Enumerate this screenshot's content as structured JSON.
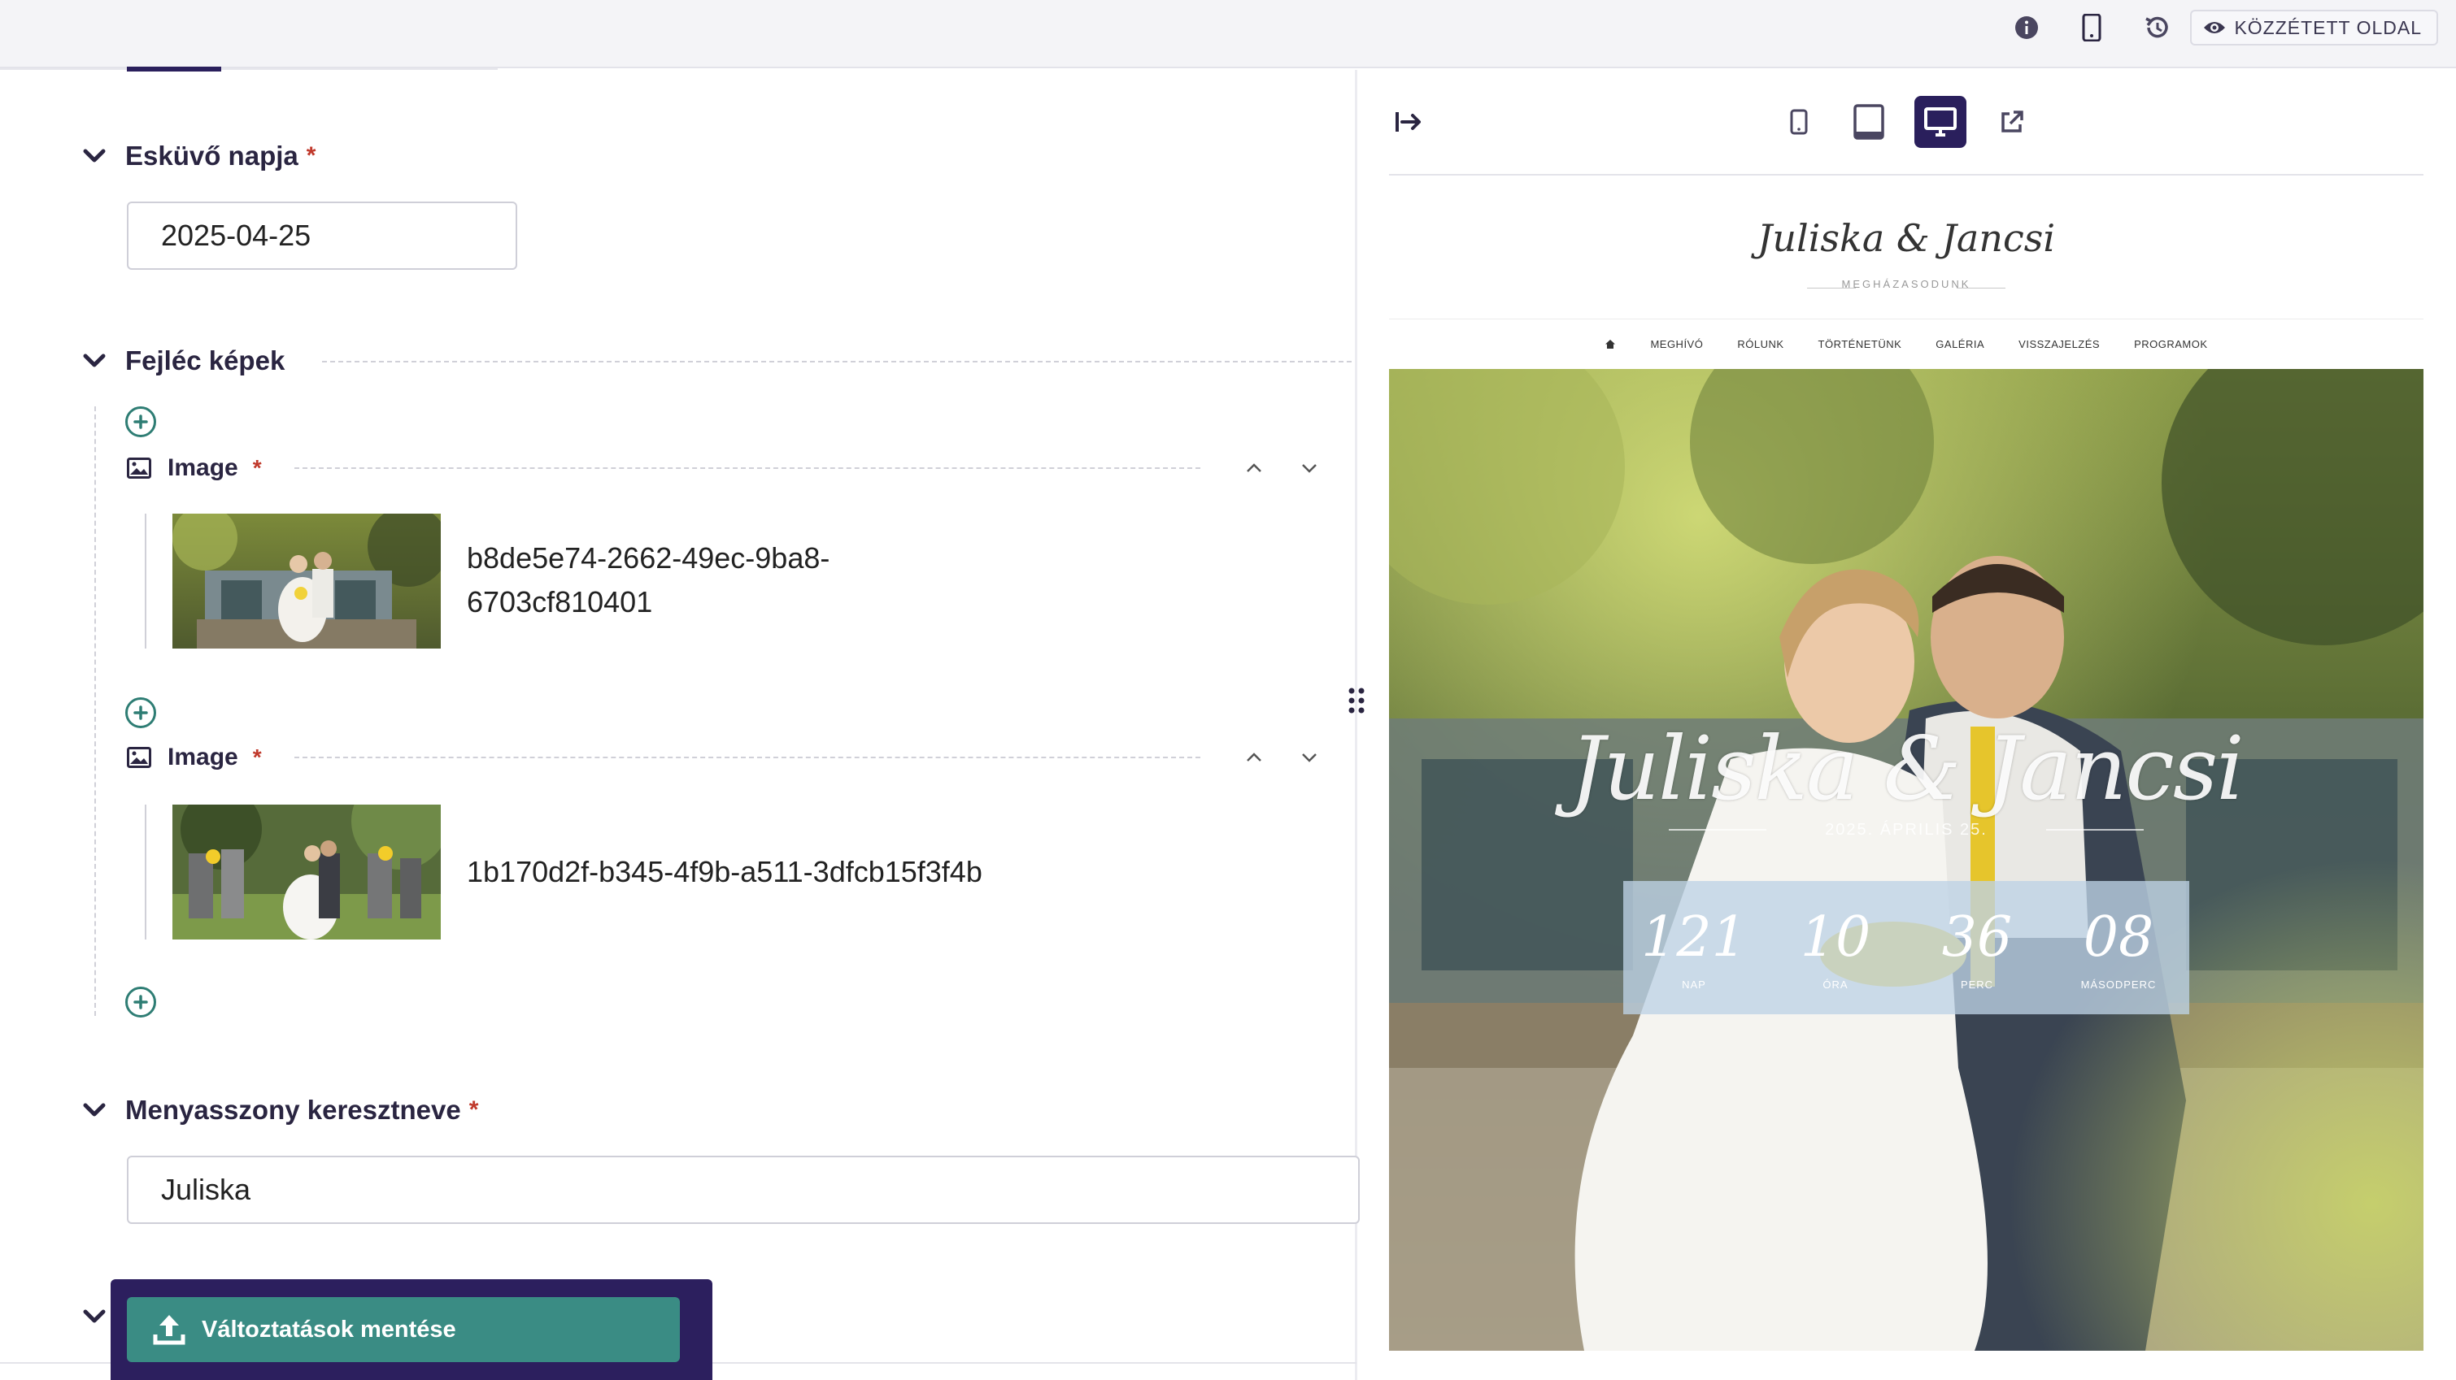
{
  "topbar": {
    "icons": [
      "info-icon",
      "mobile-icon",
      "history-icon"
    ],
    "published_label": "KÖZZÉTETT OLDAL"
  },
  "editor": {
    "wedding_date": {
      "label": "Esküvő napja",
      "required": "*",
      "value": "2025-04-25"
    },
    "header_images": {
      "label": "Fejléc képek",
      "required": "*",
      "items": [
        {
          "label": "Image",
          "required": "*",
          "file_line1": "b8de5e74-2662-49ec-9ba8-",
          "file_line2": "6703cf810401"
        },
        {
          "label": "Image",
          "required": "*",
          "file_line1": "1b170d2f-b345-4f9b-a511-3dfcb15f3f4b"
        }
      ]
    },
    "bride_first_name": {
      "label": "Menyasszony keresztneve",
      "required": "*",
      "value": "Juliska"
    }
  },
  "save": {
    "label": "Változtatások mentése"
  },
  "preview": {
    "devices": [
      "mobile-icon",
      "tablet-icon",
      "desktop-icon",
      "external-link-icon"
    ],
    "active_device": "desktop",
    "site": {
      "logo": "Juliska & Jancsi",
      "tagline": "MEGHÁZASODUNK",
      "nav": [
        "MEGHÍVÓ",
        "RÓLUNK",
        "TÖRTÉNETÜNK",
        "GALÉRIA",
        "VISSZAJELZÉS",
        "PROGRAMOK"
      ],
      "hero_title": "Juliska & Jancsi",
      "hero_date": "2025. ÁPRILIS 25.",
      "countdown": [
        {
          "value": "121",
          "label": "NAP"
        },
        {
          "value": "10",
          "label": "ÓRA"
        },
        {
          "value": "36",
          "label": "PERC"
        },
        {
          "value": "08",
          "label": "MÁSODPERC"
        }
      ]
    }
  },
  "colors": {
    "primary_dark": "#2a1f5c",
    "accent_teal": "#3a8c84",
    "required_red": "#c0392b"
  }
}
